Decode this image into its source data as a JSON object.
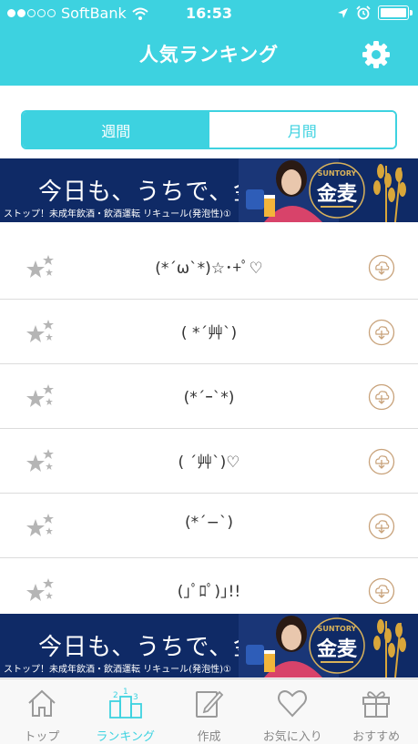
{
  "status": {
    "carrier": "SoftBank",
    "time": "16:53"
  },
  "nav": {
    "title": "人気ランキング"
  },
  "segment": {
    "items": [
      {
        "label": "週間",
        "active": true
      },
      {
        "label": "月間",
        "active": false
      }
    ]
  },
  "banner": {
    "headline": "今日も、うちで、金麦と。",
    "fine_print": "ストップ！未成年飲酒・飲酒運転 リキュール(発泡性)①",
    "brand_top": "SUNTORY",
    "brand_name": "金麦"
  },
  "ranking": [
    {
      "face": "(*´ω`*)☆･+ﾟ♡"
    },
    {
      "face": "( *´艸`)"
    },
    {
      "face": "(*´ｰ`*)"
    },
    {
      "face": "( ´艸`)♡"
    },
    {
      "face": "(*´−`)"
    },
    {
      "face": "(｣ﾟﾛﾟ)｣!!"
    }
  ],
  "tabs": [
    {
      "label": "トップ",
      "icon": "home-icon",
      "active": false
    },
    {
      "label": "ランキング",
      "icon": "ranking-podium-icon",
      "active": true
    },
    {
      "label": "作成",
      "icon": "create-edit-icon",
      "active": false
    },
    {
      "label": "お気に入り",
      "icon": "heart-icon",
      "active": false
    },
    {
      "label": "おすすめ",
      "icon": "gift-icon",
      "active": false
    }
  ],
  "colors": {
    "accent": "#3dd2e0",
    "banner_bg": "#0f2a66",
    "download_icon": "#c8a27a",
    "star_gray": "#b5b5b5"
  }
}
